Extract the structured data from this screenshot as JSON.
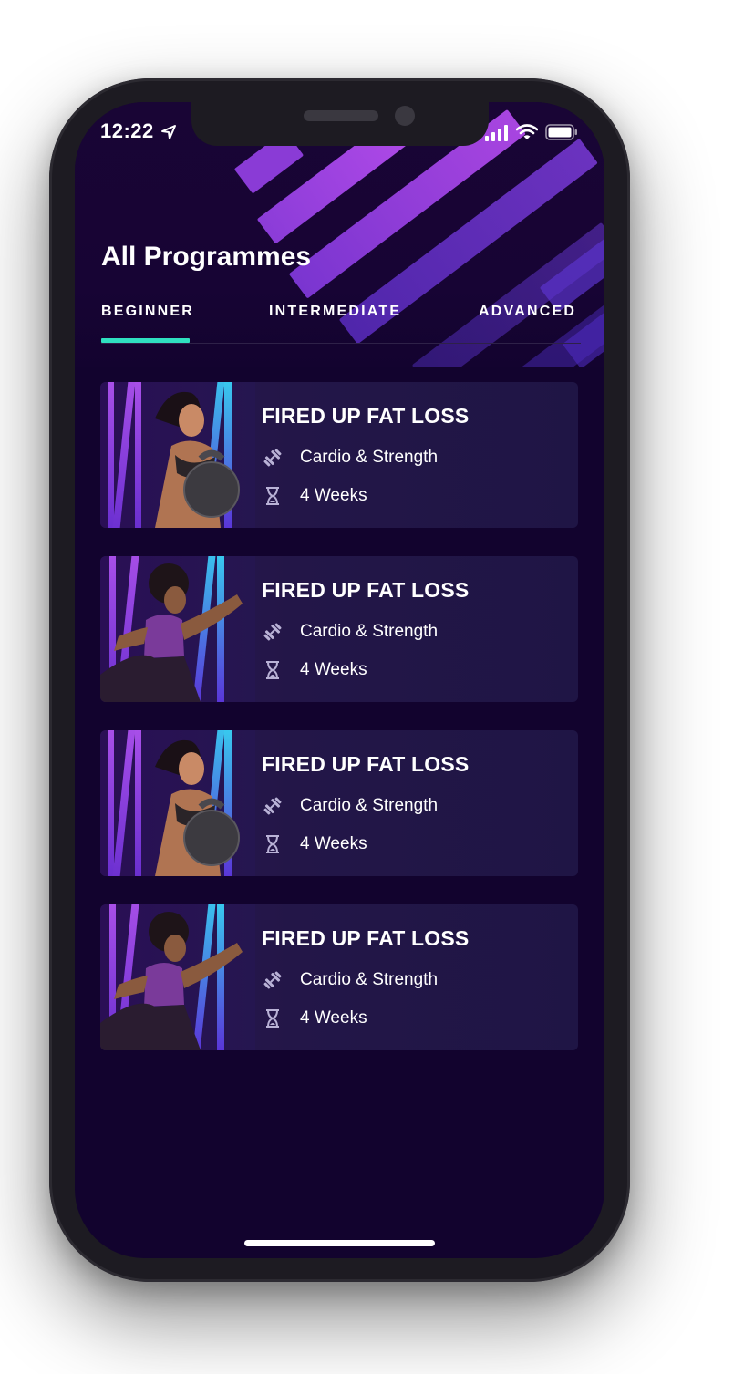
{
  "status_bar": {
    "time": "12:22"
  },
  "header": {
    "title": "All Programmes"
  },
  "tabs": [
    {
      "label": "BEGINNER",
      "active": true
    },
    {
      "label": "INTERMEDIATE",
      "active": false
    },
    {
      "label": "ADVANCED",
      "active": false
    }
  ],
  "programmes": [
    {
      "title": "FIRED UP FAT LOSS",
      "type": "Cardio & Strength",
      "duration": "4 Weeks",
      "image": "kettlebell-athlete"
    },
    {
      "title": "FIRED UP FAT LOSS",
      "type": "Cardio & Strength",
      "duration": "4 Weeks",
      "image": "sprinting-athlete"
    },
    {
      "title": "FIRED UP FAT LOSS",
      "type": "Cardio & Strength",
      "duration": "4 Weeks",
      "image": "kettlebell-athlete"
    },
    {
      "title": "FIRED UP FAT LOSS",
      "type": "Cardio & Strength",
      "duration": "4 Weeks",
      "image": "sprinting-athlete"
    }
  ],
  "colors": {
    "background": "#12032e",
    "card": "#231648",
    "accent": "#2fe0c0",
    "stripe_purple": "#9b3fe0",
    "stripe_blue": "#5a3fd8"
  },
  "icons": [
    "location-arrow-icon",
    "signal-icon",
    "wifi-icon",
    "battery-icon",
    "dumbbell-icon",
    "hourglass-icon"
  ]
}
